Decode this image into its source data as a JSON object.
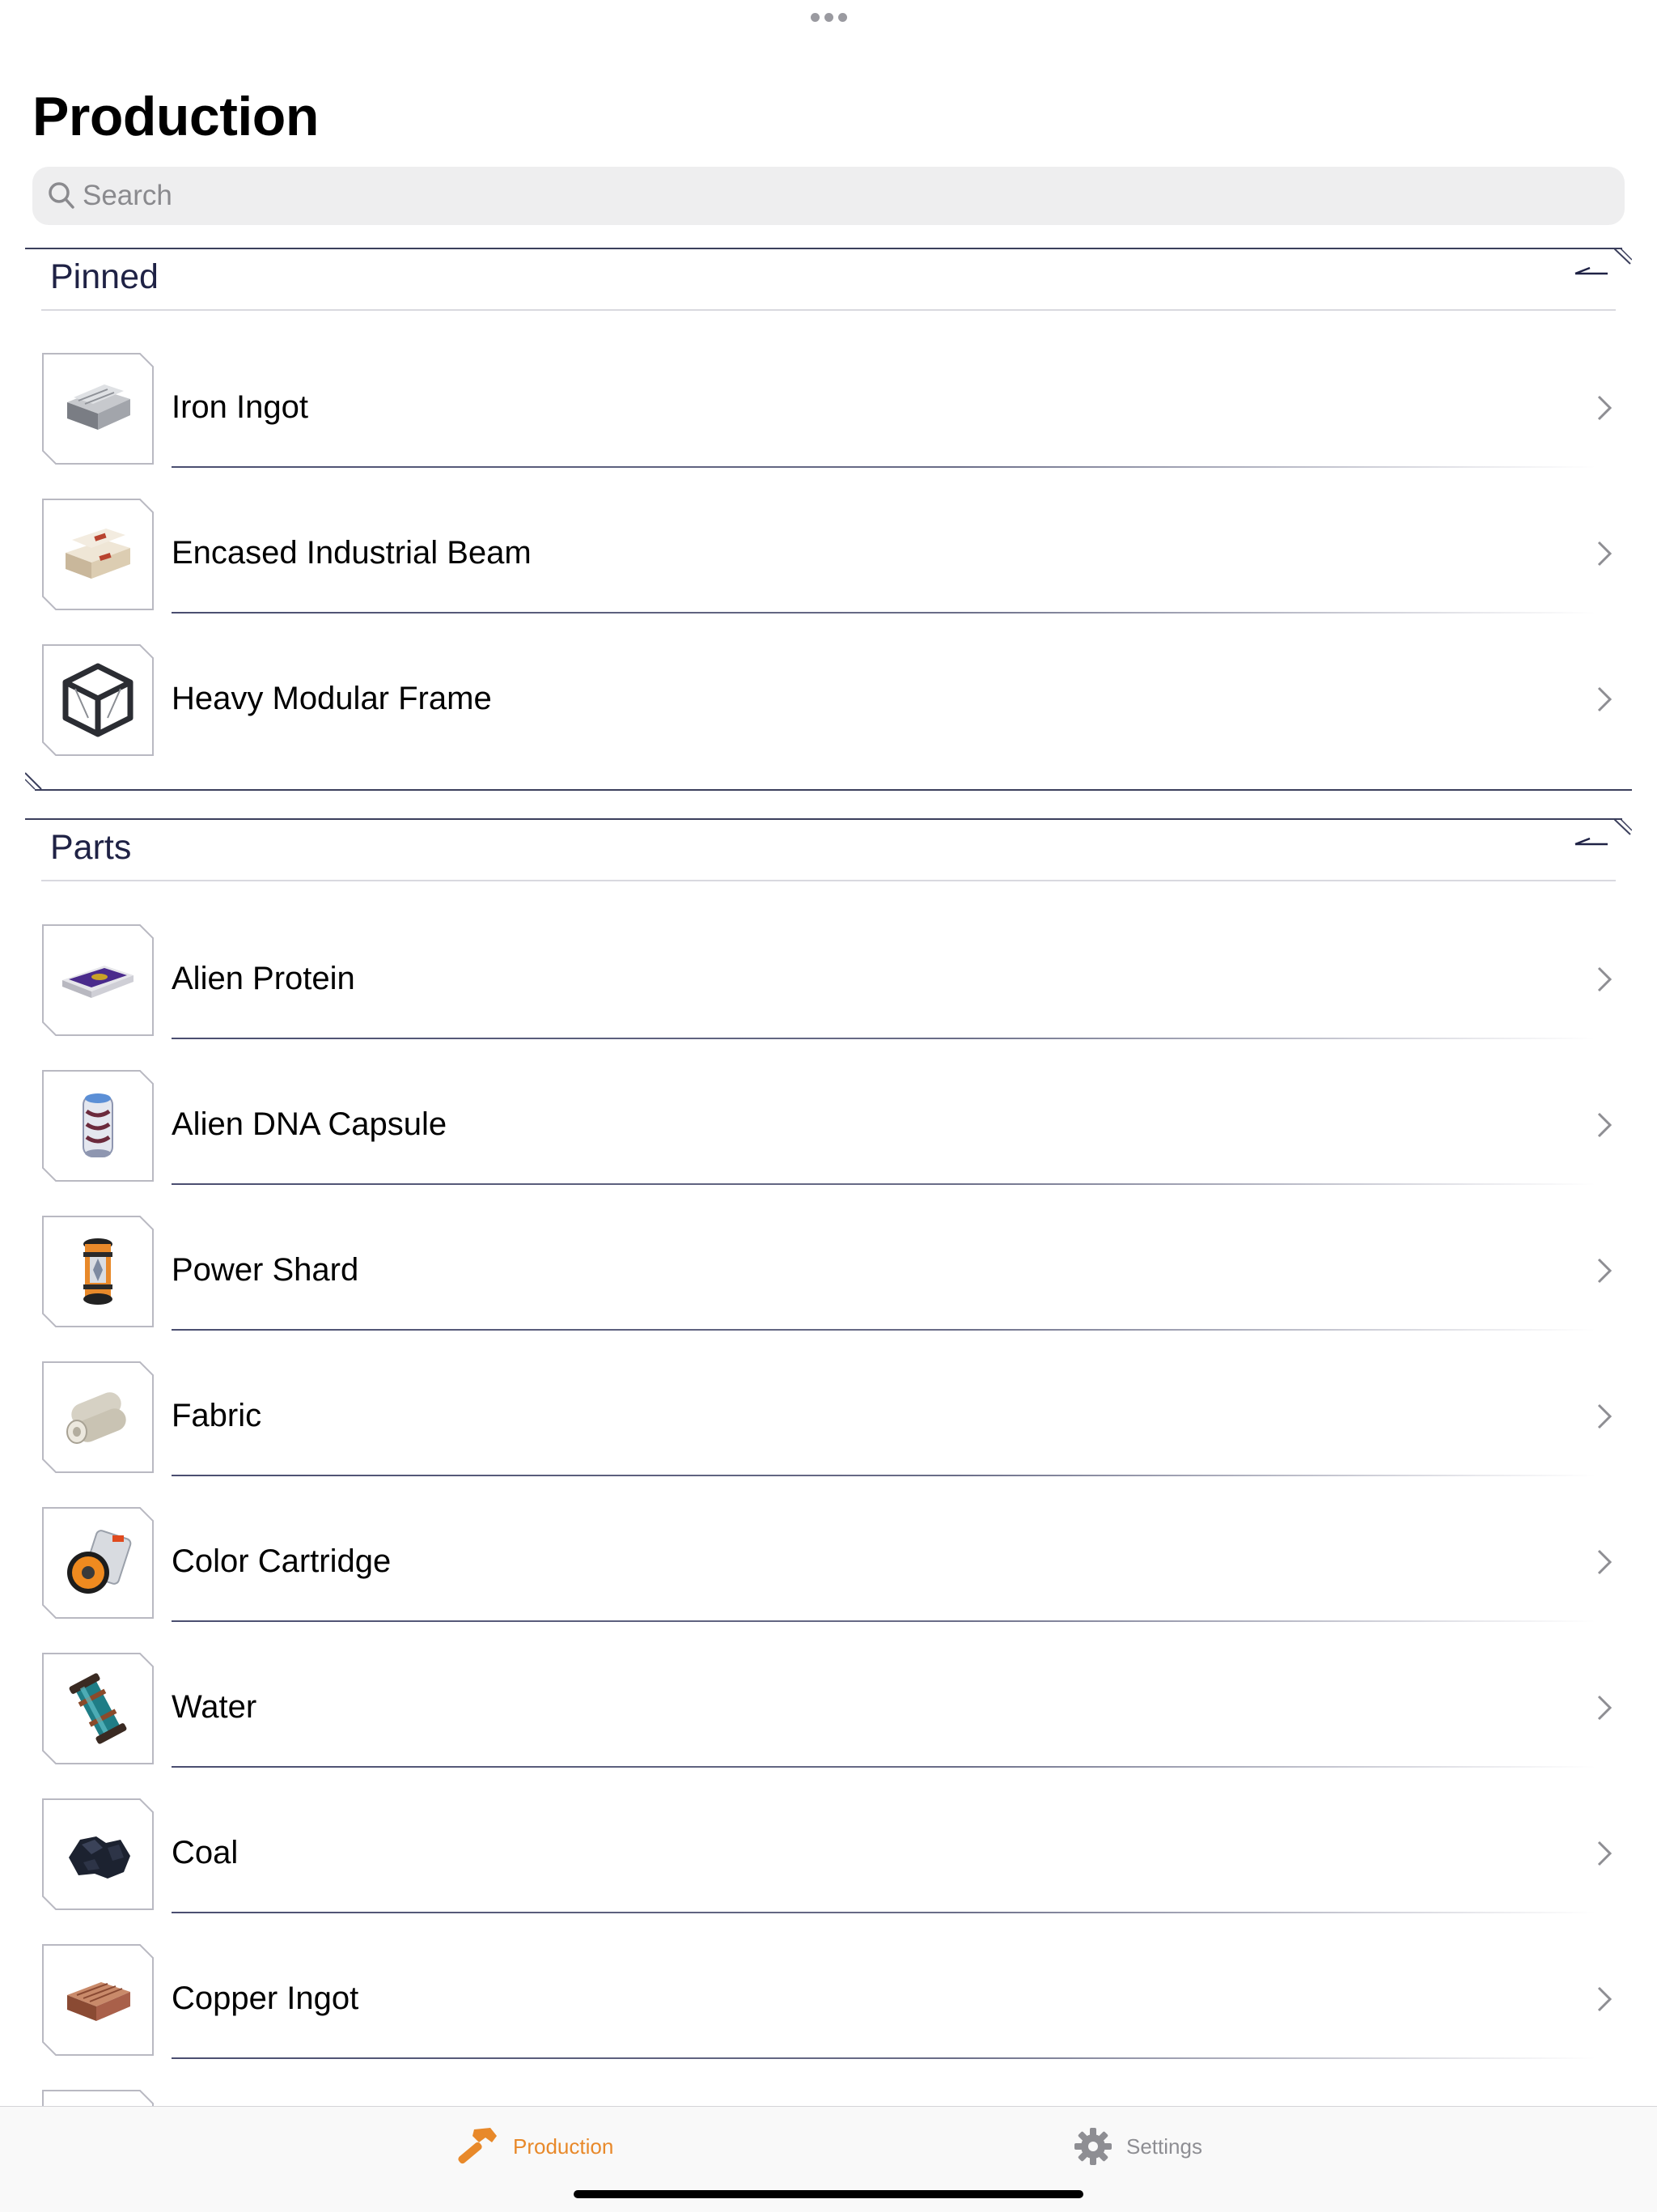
{
  "page": {
    "title": "Production"
  },
  "search": {
    "placeholder": "Search"
  },
  "sections": [
    {
      "title": "Pinned",
      "items": [
        {
          "label": "Iron Ingot",
          "icon": "iron-ingot-icon"
        },
        {
          "label": "Encased Industrial Beam",
          "icon": "encased-industrial-beam-icon"
        },
        {
          "label": "Heavy Modular Frame",
          "icon": "heavy-modular-frame-icon"
        }
      ]
    },
    {
      "title": "Parts",
      "items": [
        {
          "label": "Alien Protein",
          "icon": "alien-protein-icon"
        },
        {
          "label": "Alien DNA Capsule",
          "icon": "alien-dna-capsule-icon"
        },
        {
          "label": "Power Shard",
          "icon": "power-shard-icon"
        },
        {
          "label": "Fabric",
          "icon": "fabric-icon"
        },
        {
          "label": "Color Cartridge",
          "icon": "color-cartridge-icon"
        },
        {
          "label": "Water",
          "icon": "water-icon"
        },
        {
          "label": "Coal",
          "icon": "coal-icon"
        },
        {
          "label": "Copper Ingot",
          "icon": "copper-ingot-icon"
        }
      ]
    }
  ],
  "tabbar": {
    "tabs": [
      {
        "label": "Production",
        "icon": "hammer-icon",
        "selected": true
      },
      {
        "label": "Settings",
        "icon": "gear-icon",
        "selected": false
      }
    ]
  },
  "colors": {
    "accent": "#e8892a",
    "section_title": "#1f2245",
    "divider": "#3b3f5c",
    "tab_inactive": "#8e8e93"
  }
}
